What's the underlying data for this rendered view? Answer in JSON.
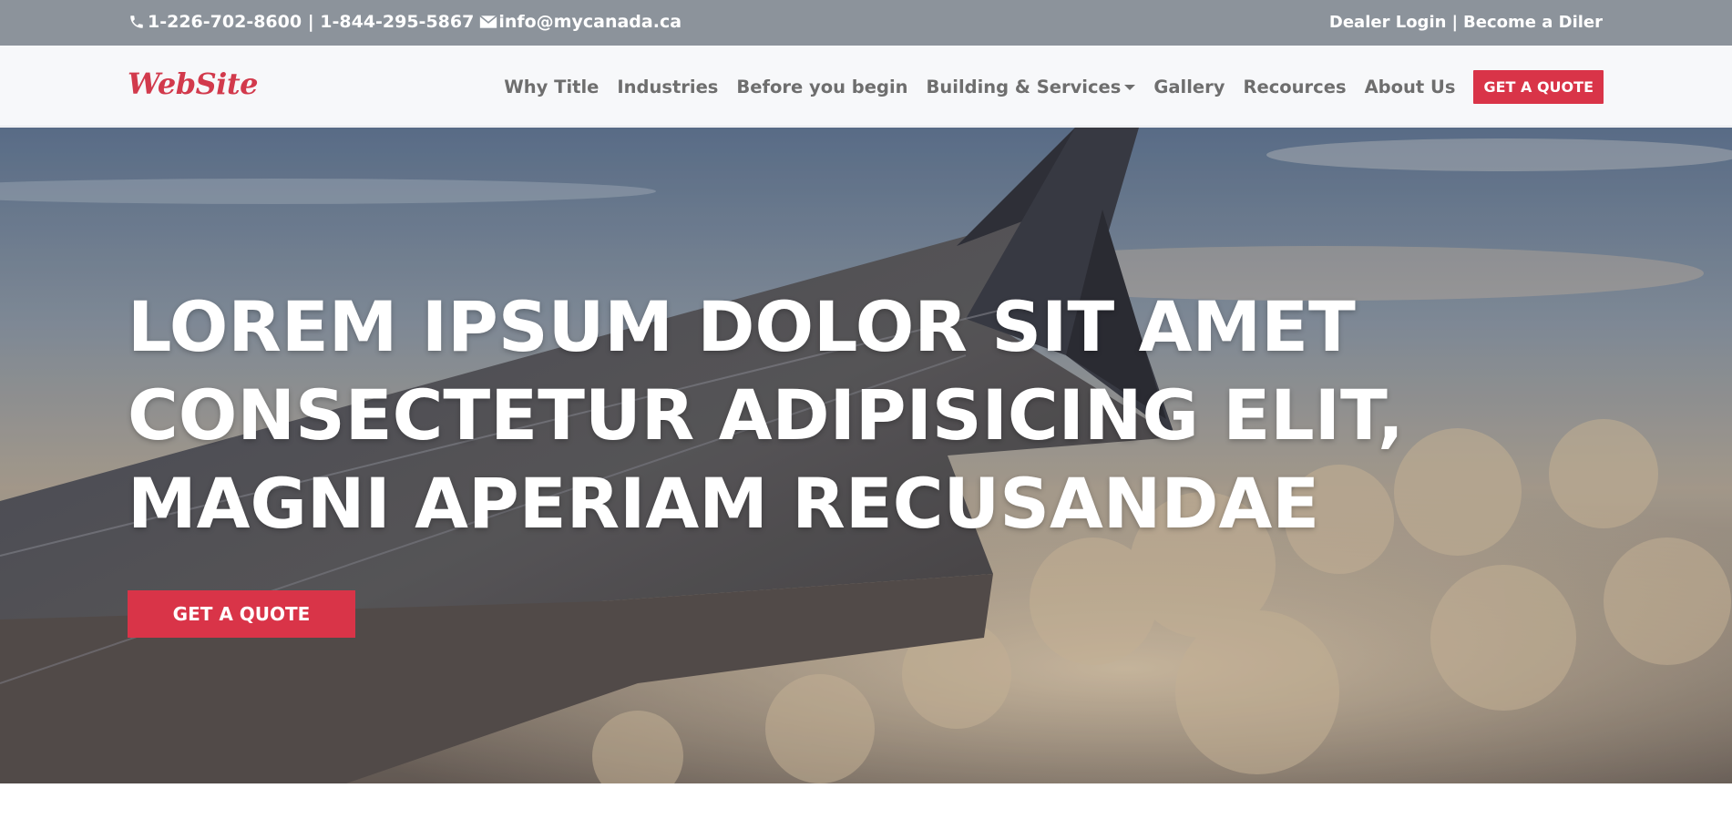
{
  "topbar": {
    "phone_icon": "phone-icon",
    "phones": "1-226-702-8600 | 1-844-295-5867",
    "email_icon": "envelope-icon",
    "email": "info@mycanada.ca",
    "dealer_login": "Dealer Login",
    "separator": "|",
    "become_dealer": "Become a Diler"
  },
  "navbar": {
    "logo": "WebSite",
    "items": [
      {
        "label": "Why Title"
      },
      {
        "label": "Industries"
      },
      {
        "label": "Before you begin"
      },
      {
        "label": "Building & Services"
      },
      {
        "label": "Gallery"
      },
      {
        "label": "Recources"
      },
      {
        "label": "About Us"
      }
    ],
    "cta": "GET A QUOTE"
  },
  "hero": {
    "title_lines": [
      "LOREM IPSUM DOLOR SIT AMET",
      "CONSECTETUR ADIPISICING ELIT,",
      "MAGNI APERIAM RECUSANDAE"
    ],
    "cta": "GET A QUOTE"
  },
  "colors": {
    "accent": "#d93448",
    "topbar_bg": "#8c939b",
    "navbar_bg": "#f7f8fa",
    "nav_text": "#6e6e6e"
  }
}
